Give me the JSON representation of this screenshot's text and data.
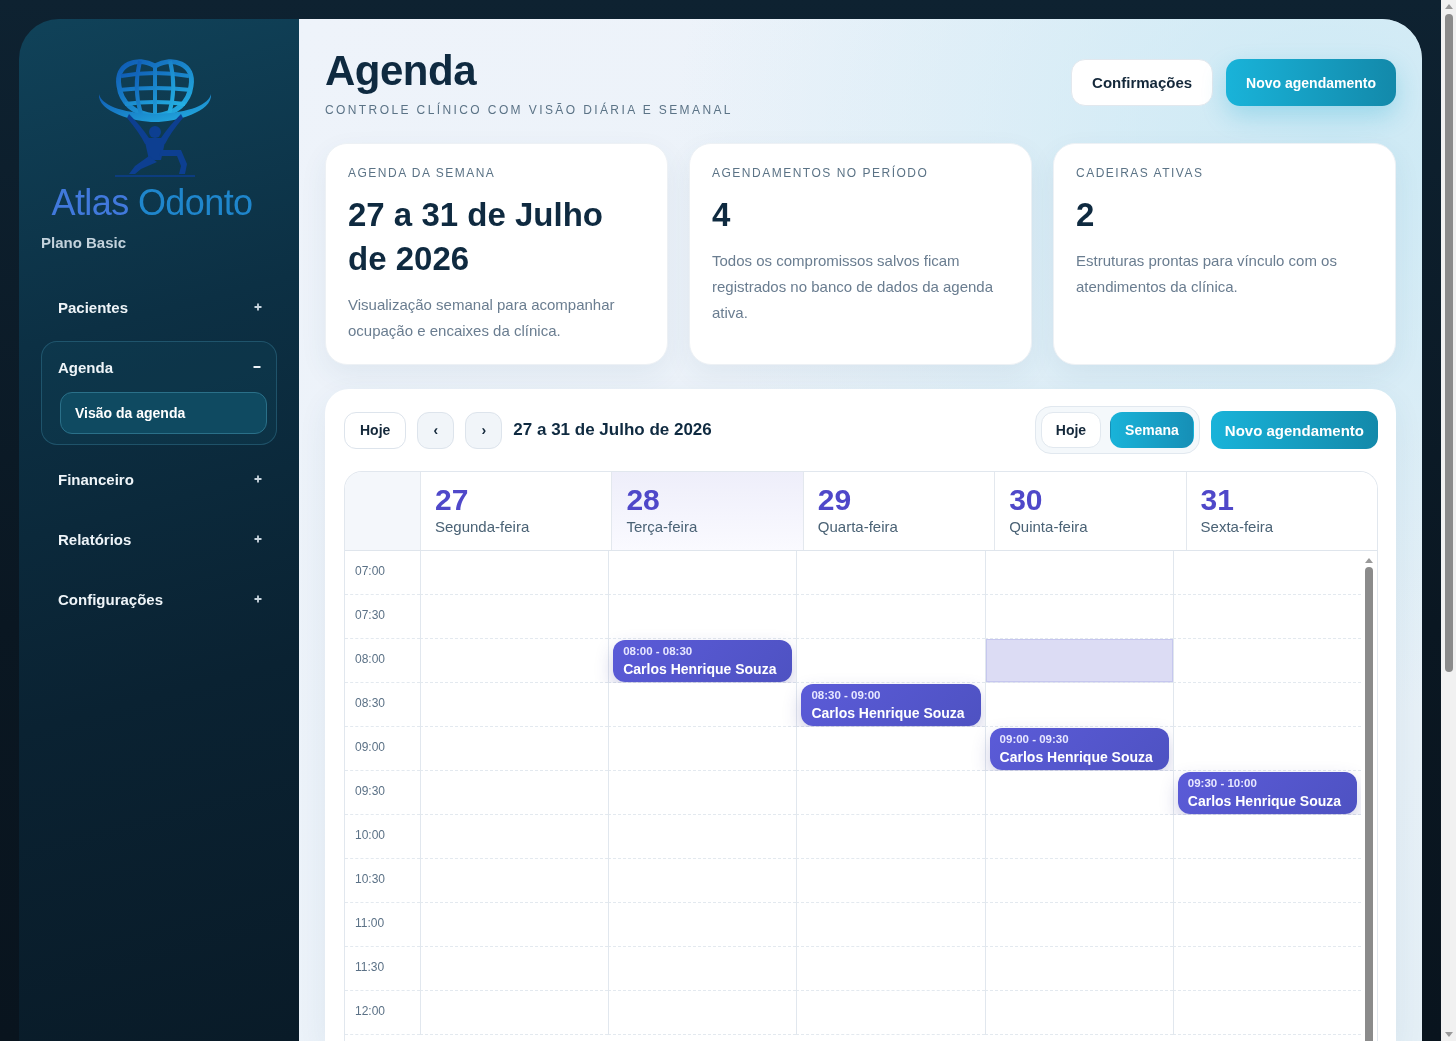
{
  "sidebar": {
    "wordmark": [
      "Atlas",
      "Odonto"
    ],
    "plan": "Plano Basic",
    "nav": [
      {
        "label": "Pacientes",
        "expanded": false
      },
      {
        "label": "Agenda",
        "expanded": true,
        "children": [
          {
            "label": "Visão da agenda",
            "selected": true
          }
        ]
      },
      {
        "label": "Financeiro",
        "expanded": false
      },
      {
        "label": "Relatórios",
        "expanded": false
      },
      {
        "label": "Configurações",
        "expanded": false
      }
    ]
  },
  "header": {
    "title": "Agenda",
    "subtitle": "CONTROLE CLÍNICO COM VISÃO DIÁRIA E SEMANAL",
    "buttons": [
      {
        "label": "Confirmações",
        "kind": "secondary"
      },
      {
        "label": "Novo agendamento",
        "kind": "primary"
      }
    ]
  },
  "stats": [
    {
      "label": "AGENDA DA SEMANA",
      "value": "27 a 31 de Julho de 2026",
      "description": "Visualização semanal para acompanhar ocupação e encaixes da clínica."
    },
    {
      "label": "AGENDAMENTOS NO PERÍODO",
      "value": "4",
      "description": "Todos os compromissos salvos ficam registrados no banco de dados da agenda ativa."
    },
    {
      "label": "CADEIRAS ATIVAS",
      "value": "2",
      "description": "Estruturas prontas para vínculo com os atendimentos da clínica."
    }
  ],
  "calendar": {
    "today_button": "Hoje",
    "prev_button": "‹",
    "next_button": "›",
    "range": "27 a 31 de Julho de 2026",
    "views": [
      {
        "label": "Hoje",
        "selected": false
      },
      {
        "label": "Semana",
        "selected": true
      }
    ],
    "new_button": "Novo agendamento",
    "days": [
      {
        "number": "27",
        "weekday": "Segunda-feira",
        "highlighted": false
      },
      {
        "number": "28",
        "weekday": "Terça-feira",
        "highlighted": true
      },
      {
        "number": "29",
        "weekday": "Quarta-feira",
        "highlighted": false
      },
      {
        "number": "30",
        "weekday": "Quinta-feira",
        "highlighted": false
      },
      {
        "number": "31",
        "weekday": "Sexta-feira",
        "highlighted": false
      }
    ],
    "rows": [
      {
        "time": "07:00",
        "cells": [
          {
            "selected": false
          },
          {
            "selected": false
          },
          {
            "selected": false
          },
          {
            "selected": false
          },
          {
            "selected": false
          }
        ]
      },
      {
        "time": "07:30",
        "cells": [
          {
            "selected": false
          },
          {
            "selected": false
          },
          {
            "selected": false
          },
          {
            "selected": false
          },
          {
            "selected": false
          }
        ]
      },
      {
        "time": "08:00",
        "cells": [
          {
            "selected": false
          },
          {
            "selected": false,
            "appointment": {
              "time": "08:00 - 08:30",
              "patient": "Carlos Henrique Souza"
            }
          },
          {
            "selected": false
          },
          {
            "selected": true
          },
          {
            "selected": false
          }
        ]
      },
      {
        "time": "08:30",
        "cells": [
          {
            "selected": false
          },
          {
            "selected": false
          },
          {
            "selected": false,
            "appointment": {
              "time": "08:30 - 09:00",
              "patient": "Carlos Henrique Souza"
            }
          },
          {
            "selected": false
          },
          {
            "selected": false
          }
        ]
      },
      {
        "time": "09:00",
        "cells": [
          {
            "selected": false
          },
          {
            "selected": false
          },
          {
            "selected": false
          },
          {
            "selected": false,
            "appointment": {
              "time": "09:00 - 09:30",
              "patient": "Carlos Henrique Souza"
            }
          },
          {
            "selected": false
          }
        ]
      },
      {
        "time": "09:30",
        "cells": [
          {
            "selected": false
          },
          {
            "selected": false
          },
          {
            "selected": false
          },
          {
            "selected": false
          },
          {
            "selected": false,
            "appointment": {
              "time": "09:30 - 10:00",
              "patient": "Carlos Henrique Souza"
            }
          }
        ]
      },
      {
        "time": "10:00",
        "cells": [
          {
            "selected": false
          },
          {
            "selected": false
          },
          {
            "selected": false
          },
          {
            "selected": false
          },
          {
            "selected": false
          }
        ]
      },
      {
        "time": "10:30",
        "cells": [
          {
            "selected": false
          },
          {
            "selected": false
          },
          {
            "selected": false
          },
          {
            "selected": false
          },
          {
            "selected": false
          }
        ]
      },
      {
        "time": "11:00",
        "cells": [
          {
            "selected": false
          },
          {
            "selected": false
          },
          {
            "selected": false
          },
          {
            "selected": false
          },
          {
            "selected": false
          }
        ]
      },
      {
        "time": "11:30",
        "cells": [
          {
            "selected": false
          },
          {
            "selected": false
          },
          {
            "selected": false
          },
          {
            "selected": false
          },
          {
            "selected": false
          }
        ]
      },
      {
        "time": "12:00",
        "cells": [
          {
            "selected": false
          },
          {
            "selected": false
          },
          {
            "selected": false
          },
          {
            "selected": false
          },
          {
            "selected": false
          }
        ]
      }
    ]
  }
}
